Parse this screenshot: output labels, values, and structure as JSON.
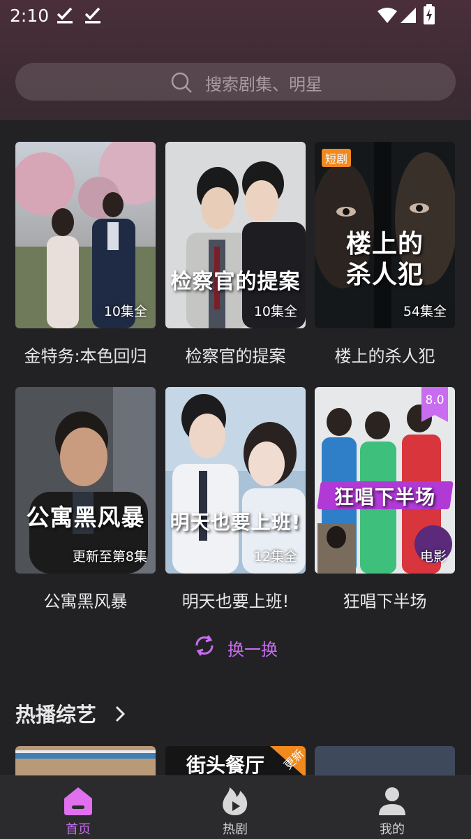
{
  "status_bar": {
    "time": "2:10"
  },
  "search": {
    "placeholder": "搜索剧集、明星"
  },
  "cards": [
    {
      "title": "金特务:本色回归",
      "episodes": "10集全",
      "badge": "",
      "rating": "",
      "poster_text": ""
    },
    {
      "title": "检察官的提案",
      "episodes": "10集全",
      "badge": "",
      "rating": "",
      "poster_text": "检察官的提案"
    },
    {
      "title": "楼上的杀人犯",
      "episodes": "54集全",
      "badge": "短剧",
      "rating": "",
      "poster_text": "楼上的\n杀人犯"
    },
    {
      "title": "公寓黑风暴",
      "episodes": "更新至第8集",
      "badge": "",
      "rating": "",
      "poster_text": "公寓黑风暴"
    },
    {
      "title": "明天也要上班!",
      "episodes": "12集全",
      "badge": "",
      "rating": "",
      "poster_text": "明天也要上班!"
    },
    {
      "title": "狂唱下半场",
      "episodes": "电影",
      "badge": "",
      "rating": "8.0",
      "poster_text": "狂唱下半场"
    }
  ],
  "refresh": {
    "label": "换一换"
  },
  "section": {
    "title": "热播综艺"
  },
  "strip_posters": [
    {
      "text": ""
    },
    {
      "text": "街头餐厅",
      "corner": "更新"
    },
    {
      "text": ""
    }
  ],
  "nav": {
    "home": "首页",
    "hot": "热剧",
    "mine": "我的"
  },
  "colors": {
    "accent": "#c86df0",
    "badge_orange": "#f08a1f",
    "background": "#222225"
  }
}
